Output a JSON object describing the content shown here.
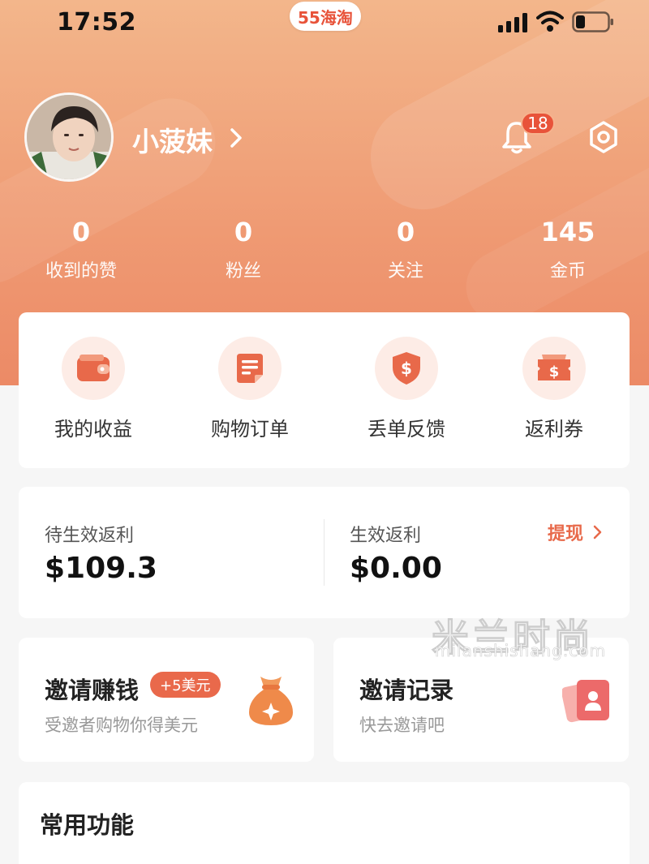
{
  "status_bar": {
    "time": "17:52",
    "app_pill": "55海淘"
  },
  "profile": {
    "username": "小菠妹",
    "notification_count": "18"
  },
  "stats": [
    {
      "value": "0",
      "label": "收到的赞"
    },
    {
      "value": "0",
      "label": "粉丝"
    },
    {
      "value": "0",
      "label": "关注"
    },
    {
      "value": "145",
      "label": "金币"
    }
  ],
  "quick_actions": [
    {
      "label": "我的收益",
      "icon": "wallet-icon"
    },
    {
      "label": "购物订单",
      "icon": "order-icon"
    },
    {
      "label": "丢单反馈",
      "icon": "shield-dollar-icon"
    },
    {
      "label": "返利券",
      "icon": "coupon-icon"
    }
  ],
  "rebate": {
    "pending_label": "待生效返利",
    "pending_value": "$109.3",
    "active_label": "生效返利",
    "active_value": "$0.00",
    "withdraw_label": "提现"
  },
  "invite": {
    "title": "邀请赚钱",
    "bonus": "+5美元",
    "subtitle": "受邀者购物你得美元"
  },
  "records": {
    "title": "邀请记录",
    "subtitle": "快去邀请吧"
  },
  "common": {
    "title": "常用功能"
  },
  "watermark": {
    "text": "米兰时尚",
    "sub": "milanshishang.com"
  },
  "colors": {
    "accent": "#e8533a",
    "hero_top": "#f3b68b",
    "hero_bottom": "#ec8a66",
    "icon_bg": "#fdece6"
  }
}
